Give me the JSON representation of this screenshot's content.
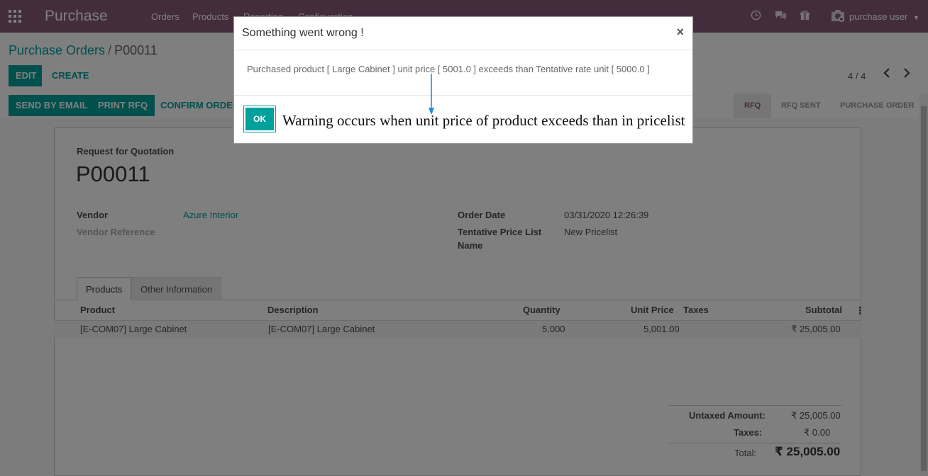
{
  "navbar": {
    "app_title": "Purchase",
    "menu": [
      "Orders",
      "Products",
      "Reporting",
      "Configuration"
    ],
    "user": "purchase user"
  },
  "breadcrumb": {
    "parent": "Purchase Orders",
    "separator": "/",
    "current": "P00011"
  },
  "buttons": {
    "edit": "EDIT",
    "create": "CREATE",
    "send_email": "SEND BY EMAIL",
    "print_rfq": "PRINT RFQ",
    "confirm_order": "CONFIRM ORDER"
  },
  "pager": {
    "text": "4 / 4"
  },
  "status_steps": [
    "RFQ",
    "RFQ SENT",
    "PURCHASE ORDER"
  ],
  "form": {
    "doc_type": "Request for Quotation",
    "name": "P00011",
    "vendor_label": "Vendor",
    "vendor_value": "Azure Interior",
    "vendor_ref_label": "Vendor Reference",
    "order_date_label": "Order Date",
    "order_date_value": "03/31/2020 12:26:39",
    "pricelist_label_1": "Tentative Price List",
    "pricelist_label_2": "Name",
    "pricelist_value": "New Pricelist"
  },
  "tabs": [
    "Products",
    "Other Information"
  ],
  "table": {
    "headers": [
      "Product",
      "Description",
      "Quantity",
      "Unit Price",
      "Taxes",
      "Subtotal"
    ],
    "rows": [
      {
        "product": "[E-COM07] Large Cabinet",
        "description": "[E-COM07] Large Cabinet",
        "quantity": "5.000",
        "unit_price": "5,001.00",
        "taxes": "",
        "subtotal": "₹ 25,005.00"
      }
    ]
  },
  "totals": {
    "untaxed_label": "Untaxed Amount:",
    "untaxed_value": "₹ 25,005.00",
    "taxes_label": "Taxes:",
    "taxes_value": "₹ 0.00",
    "total_label": "Total:",
    "total_value": "₹ 25,005.00"
  },
  "modal": {
    "title": "Something went wrong !",
    "close": "×",
    "message": "Purchased product [ Large Cabinet ] unit price [ 5001.0 ] exceeds than Tentative rate unit [ 5000.0 ]",
    "ok": "OK",
    "annotation": "Warning occurs when unit price of product exceeds than in pricelist"
  },
  "colors": {
    "brand": "#875a7b",
    "accent": "#00a09d"
  }
}
